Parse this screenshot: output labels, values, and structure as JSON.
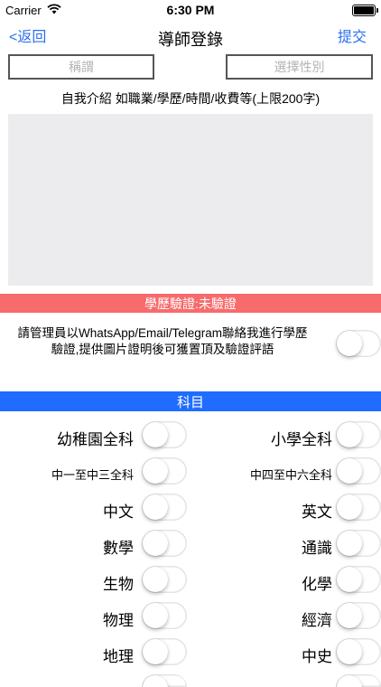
{
  "status": {
    "carrier": "Carrier",
    "time": "6:30 PM"
  },
  "nav": {
    "back": "<返回",
    "title": "導師登錄",
    "submit": "提交"
  },
  "form": {
    "title_placeholder": "稱謂",
    "gender_placeholder": "選擇性別",
    "intro_label": "自我介紹 如職業/學歷/時間/收費等(上限200字)"
  },
  "verify": {
    "bar": "學歷驗證:未驗證",
    "line1": "請管理員以WhatsApp/Email/Telegram聯絡我進行學歷",
    "line2": "驗證,提供圖片證明後可獲置頂及驗證評語"
  },
  "subjects": {
    "header": "科目",
    "left": [
      "幼稚園全科",
      "中一至中三全科",
      "中文",
      "數學",
      "生物",
      "物理",
      "地理"
    ],
    "right": [
      "小學全科",
      "中四至中六全科",
      "英文",
      "通識",
      "化學",
      "經濟",
      "中史"
    ]
  }
}
